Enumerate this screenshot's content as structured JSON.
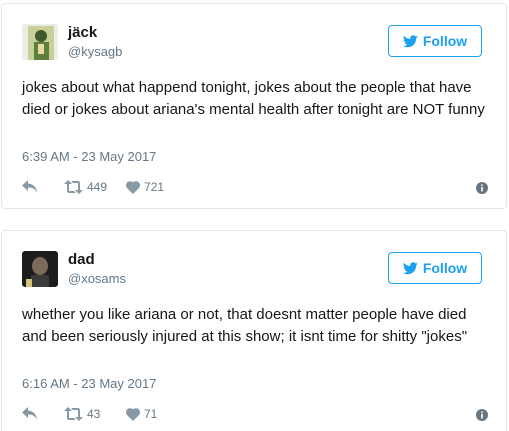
{
  "tweets": [
    {
      "name": "jäck",
      "handle": "@kysagb",
      "follow_label": "Follow",
      "text": "jokes about what happend tonight, jokes about the people that have died or jokes about ariana's mental health after tonight are NOT funny",
      "timestamp": "6:39 AM - 23 May 2017",
      "retweets": "449",
      "likes": "721"
    },
    {
      "name": "dad",
      "handle": "@xosams",
      "follow_label": "Follow",
      "text": "whether you like ariana or not, that doesnt matter people have died and been seriously injured at this show; it isnt time for shitty \"jokes\"",
      "timestamp": "6:16 AM - 23 May 2017",
      "retweets": "43",
      "likes": "71"
    }
  ],
  "colors": {
    "accent": "#1da1f2",
    "muted": "#657786",
    "border": "#e1e8ed",
    "text": "#14171a"
  },
  "icons": [
    "twitter-bird-icon",
    "reply-icon",
    "retweet-icon",
    "heart-icon",
    "info-icon"
  ]
}
